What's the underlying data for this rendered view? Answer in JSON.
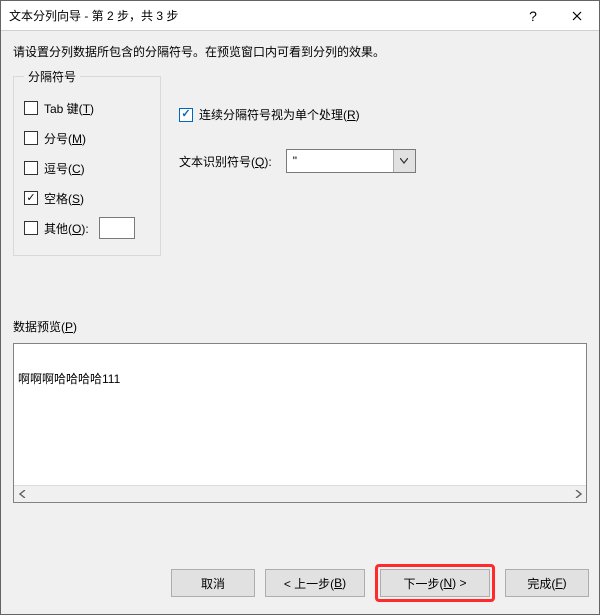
{
  "title": "文本分列向导 - 第 2 步，共 3 步",
  "instruction": "请设置分列数据所包含的分隔符号。在预览窗口内可看到分列的效果。",
  "delimiters": {
    "legend": "分隔符号",
    "tab": {
      "label_pre": "Tab 键(",
      "key": "T",
      "label_post": ")",
      "checked": false
    },
    "semi": {
      "label_pre": "分号(",
      "key": "M",
      "label_post": ")",
      "checked": false
    },
    "comma": {
      "label_pre": "逗号(",
      "key": "C",
      "label_post": ")",
      "checked": false
    },
    "space": {
      "label_pre": "空格(",
      "key": "S",
      "label_post": ")",
      "checked": true
    },
    "other": {
      "label_pre": "其他(",
      "key": "O",
      "label_post": "):",
      "checked": false,
      "value": ""
    }
  },
  "consecutive": {
    "checked": true,
    "label_pre": "连续分隔符号视为单个处理(",
    "key": "R",
    "label_post": ")"
  },
  "qualifier": {
    "label_pre": "文本识别符号(",
    "key": "Q",
    "label_post": "):",
    "value": "\""
  },
  "preview": {
    "label_pre": "数据预览(",
    "key": "P",
    "label_post": ")",
    "rows": [
      "啊啊啊哈哈哈哈111"
    ]
  },
  "buttons": {
    "cancel": "取消",
    "back_pre": "< 上一步(",
    "back_key": "B",
    "back_post": ")",
    "next_pre": "下一步(",
    "next_key": "N",
    "next_post": ") >",
    "finish_pre": "完成(",
    "finish_key": "F",
    "finish_post": ")"
  }
}
